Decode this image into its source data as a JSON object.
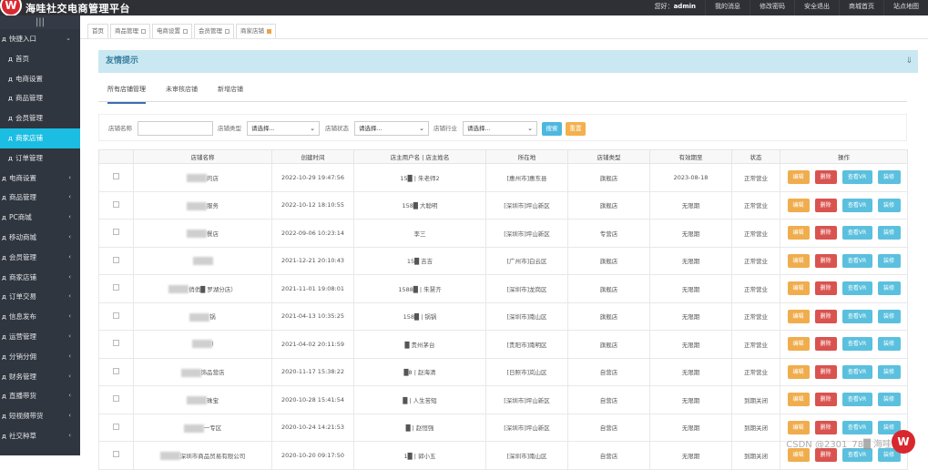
{
  "app": {
    "logo_letter": "W",
    "title": "海哇社交电商管理平台"
  },
  "topnav": {
    "greeting_prefix": "您好：",
    "username": "admin",
    "links": [
      "我的消息",
      "修改密码",
      "安全退出",
      "商城首页",
      "站点地图"
    ]
  },
  "sidebar": {
    "toggle_icon": "|||",
    "items": [
      {
        "label": "快捷入口",
        "level": 1,
        "expanded": true
      },
      {
        "label": "首页",
        "level": 2
      },
      {
        "label": "电商设置",
        "level": 2
      },
      {
        "label": "商品管理",
        "level": 2
      },
      {
        "label": "会员管理",
        "level": 2
      },
      {
        "label": "商家店铺",
        "level": 2,
        "active": true
      },
      {
        "label": "订单管理",
        "level": 2
      },
      {
        "label": "电商设置",
        "level": 1
      },
      {
        "label": "商品管理",
        "level": 1
      },
      {
        "label": "PC商城",
        "level": 1
      },
      {
        "label": "移动商城",
        "level": 1
      },
      {
        "label": "会员管理",
        "level": 1
      },
      {
        "label": "商家店铺",
        "level": 1
      },
      {
        "label": "订单交易",
        "level": 1
      },
      {
        "label": "信息发布",
        "level": 1
      },
      {
        "label": "运营管理",
        "level": 1
      },
      {
        "label": "分销分佣",
        "level": 1
      },
      {
        "label": "财务管理",
        "level": 1
      },
      {
        "label": "直播带货",
        "level": 1
      },
      {
        "label": "短视频带货",
        "level": 1
      },
      {
        "label": "社交种草",
        "level": 1
      }
    ]
  },
  "tabs": [
    {
      "label": "首页",
      "closable": false
    },
    {
      "label": "商品管理",
      "closable": true
    },
    {
      "label": "电商设置",
      "closable": true
    },
    {
      "label": "会员管理",
      "closable": true
    },
    {
      "label": "商家店铺",
      "closable": true,
      "active": true
    }
  ],
  "notice": {
    "title": "友情提示",
    "toggle_icon": "double-chevron-down"
  },
  "subtabs": [
    {
      "label": "所有店铺管理",
      "active": true
    },
    {
      "label": "未审核店铺"
    },
    {
      "label": "新增店铺"
    }
  ],
  "filter": {
    "store_name_label": "店铺名称",
    "store_name_value": "",
    "store_type_label": "店铺类型",
    "store_type_value": "请选择...",
    "store_status_label": "店铺状态",
    "store_status_value": "请选择...",
    "store_industry_label": "店铺行业",
    "store_industry_value": "请选择...",
    "search_label": "搜索",
    "reset_label": "重置"
  },
  "table": {
    "headers": [
      "",
      "店铺名称",
      "创建时间",
      "店主用户名 | 店主姓名",
      "所在地",
      "店铺类型",
      "有效期至",
      "状态",
      "操作"
    ],
    "actions": {
      "edit": "编辑",
      "delete": "删除",
      "view_vr": "查看VR",
      "decorate": "装修"
    },
    "rows": [
      {
        "name": "的店",
        "created": "2022-10-29 19:47:56",
        "owner": "15█ | 朱老师2",
        "location": "[惠州市]惠东县",
        "type": "旗舰店",
        "expires": "2023-08-18",
        "status": "正常营业"
      },
      {
        "name": "服务",
        "created": "2022-10-12 18:10:55",
        "owner": "158█ 大聪明",
        "location": "[深圳市]坪山新区",
        "type": "旗舰店",
        "expires": "无限期",
        "status": "正常营业"
      },
      {
        "name": "餐店",
        "created": "2022-09-06 10:23:14",
        "owner": "李三",
        "location": "[深圳市]坪山新区",
        "type": "专营店",
        "expires": "无限期",
        "status": "正常营业"
      },
      {
        "name": "",
        "created": "2021-12-21 20:10:43",
        "owner": "15█ 吉吉",
        "location": "[广州市]白云区",
        "type": "旗舰店",
        "expires": "无限期",
        "status": "正常营业"
      },
      {
        "name": "俏俏█ 罗湖分店）",
        "created": "2021-11-01 19:08:01",
        "owner": "1588█ | 朱慧齐",
        "location": "[深圳市]龙岗区",
        "type": "旗舰店",
        "expires": "无限期",
        "status": "正常营业"
      },
      {
        "name": "锅",
        "created": "2021-04-13 10:35:25",
        "owner": "158█ | 锅锅",
        "location": "[深圳市]南山区",
        "type": "旗舰店",
        "expires": "无限期",
        "status": "正常营业"
      },
      {
        "name": "I",
        "created": "2021-04-02 20:11:59",
        "owner": "█ 贵州茅台",
        "location": "[贵阳市]南明区",
        "type": "旗舰店",
        "expires": "无限期",
        "status": "正常营业"
      },
      {
        "name": "饰品营店",
        "created": "2020-11-17 15:38:22",
        "owner": "█8 | 赵海清",
        "location": "[日照市]岚山区",
        "type": "自营店",
        "expires": "无限期",
        "status": "正常营业"
      },
      {
        "name": "珠宝",
        "created": "2020-10-28 15:41:54",
        "owner": "█ | 人生苦短",
        "location": "[深圳市]坪山新区",
        "type": "自营店",
        "expires": "无限期",
        "status": "到期关闭"
      },
      {
        "name": "一专区",
        "created": "2020-10-24 14:21:53",
        "owner": "█ | 赵恒强",
        "location": "[深圳市]坪山新区",
        "type": "自营店",
        "expires": "无限期",
        "status": "到期关闭"
      },
      {
        "name": "深圳市商品贸易有限公司",
        "created": "2020-10-20 09:17:50",
        "owner": "1█ | 郭小五",
        "location": "[深圳市]南山区",
        "type": "自营店",
        "expires": "无限期",
        "status": "到期关闭"
      }
    ]
  },
  "watermark": "CSDN @2301_78█ 海哇"
}
